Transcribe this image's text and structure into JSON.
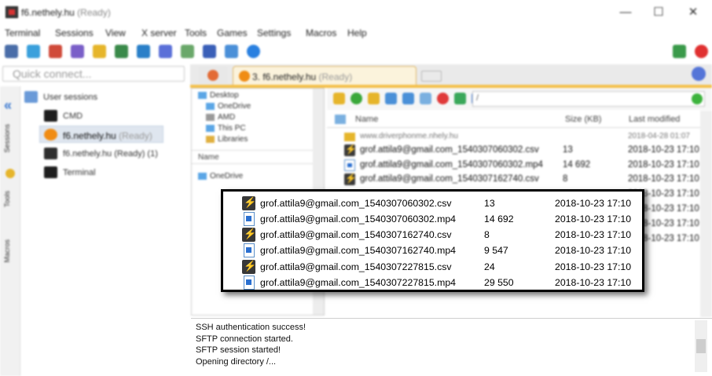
{
  "window": {
    "title": "f6.nethely.hu",
    "title_suffix": "(Ready)",
    "controls": [
      "—",
      "☐",
      "✕"
    ]
  },
  "menu": [
    "Terminal",
    "Sessions",
    "View",
    "X server",
    "Tools",
    "Games",
    "Settings",
    "Macros",
    "Help"
  ],
  "quick_connect": {
    "placeholder": "Quick connect..."
  },
  "tabs": {
    "active": {
      "label": "3. f6.nethely.hu",
      "suffix": "(Ready)"
    }
  },
  "side_tabs": [
    "Sessions",
    "Tools",
    "Macros"
  ],
  "sessions": {
    "root": "User sessions",
    "items": [
      "CMD",
      "f6.nethely.hu",
      "f6.nethely.hu (Ready)",
      "Terminal"
    ],
    "item_suffixes": [
      "",
      "(Ready)",
      "(1)",
      ""
    ]
  },
  "tree": {
    "items": [
      "Desktop",
      "OneDrive",
      "AMD",
      "This PC",
      "Libraries"
    ],
    "column_header": "Name",
    "lower_items": [
      "OneDrive"
    ]
  },
  "file_browser": {
    "path": "/",
    "columns": {
      "name": "Name",
      "size": "Size (KB)",
      "modified": "Last modified"
    },
    "rows": [
      {
        "name": "www.driverphonme.nhely.hu",
        "size": "",
        "modified": "2018-04-28 01:07",
        "type": "folder"
      },
      {
        "name": "grof.attila9@gmail.com_1540307060302.csv",
        "size": "13",
        "modified": "2018-10-23 17:10",
        "type": "csv"
      },
      {
        "name": "grof.attila9@gmail.com_1540307060302.mp4",
        "size": "14 692",
        "modified": "2018-10-23 17:10",
        "type": "mp4"
      },
      {
        "name": "grof.attila9@gmail.com_1540307162740.csv",
        "size": "8",
        "modified": "2018-10-23 17:10",
        "type": "csv"
      },
      {
        "name": "",
        "size": "",
        "modified": "2018-10-23 17:10",
        "type": "hidden"
      },
      {
        "name": "",
        "size": "",
        "modified": "2018-10-23 17:10",
        "type": "hidden"
      },
      {
        "name": "",
        "size": "",
        "modified": "2018-10-23 17:10",
        "type": "hidden"
      },
      {
        "name": "",
        "size": "",
        "modified": "2018-10-23 17:10",
        "type": "hidden"
      }
    ]
  },
  "callout": {
    "rows": [
      {
        "name": "grof.attila9@gmail.com_1540307060302.csv",
        "size": "13",
        "modified": "2018-10-23 17:10",
        "type": "csv"
      },
      {
        "name": "grof.attila9@gmail.com_1540307060302.mp4",
        "size": "14 692",
        "modified": "2018-10-23 17:10",
        "type": "mp4"
      },
      {
        "name": "grof.attila9@gmail.com_1540307162740.csv",
        "size": "8",
        "modified": "2018-10-23 17:10",
        "type": "csv"
      },
      {
        "name": "grof.attila9@gmail.com_1540307162740.mp4",
        "size": "9 547",
        "modified": "2018-10-23 17:10",
        "type": "mp4"
      },
      {
        "name": "grof.attila9@gmail.com_1540307227815.csv",
        "size": "24",
        "modified": "2018-10-23 17:10",
        "type": "csv"
      },
      {
        "name": "grof.attila9@gmail.com_1540307227815.mp4",
        "size": "29 550",
        "modified": "2018-10-23 17:10",
        "type": "mp4"
      }
    ]
  },
  "log": [
    "SSH authentication success!",
    "SFTP connection started.",
    "SFTP session started!",
    "Opening directory /..."
  ],
  "colors": {
    "tab_accent": "#f4c04a",
    "csv_icon": "#f49a16",
    "mp4_icon": "#2a6fd0",
    "close_red": "#e03030"
  }
}
